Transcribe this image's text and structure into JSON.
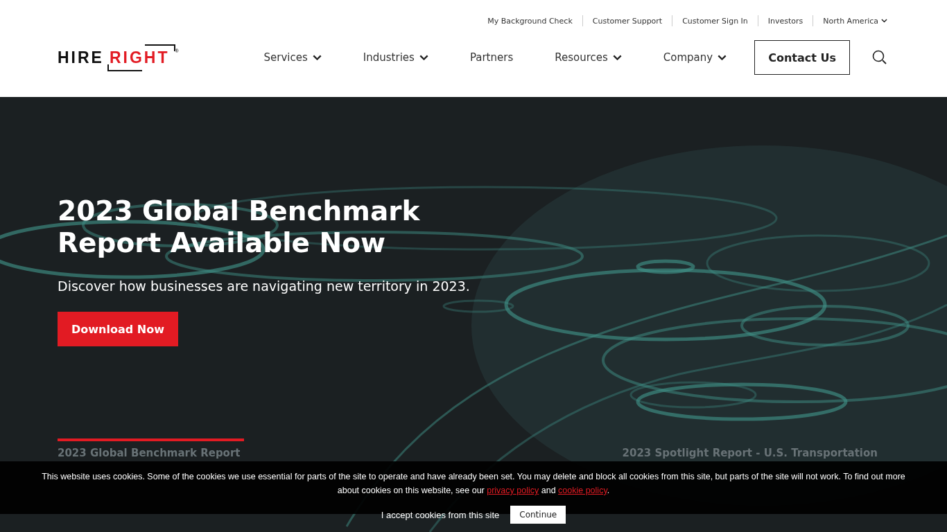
{
  "utility_links": [
    {
      "label": "My Background Check",
      "has_menu": false
    },
    {
      "label": "Customer Support",
      "has_menu": false
    },
    {
      "label": "Customer Sign In",
      "has_menu": false
    },
    {
      "label": "Investors",
      "has_menu": false
    },
    {
      "label": "North America",
      "has_menu": true
    }
  ],
  "logo": {
    "first": "HIRE",
    "second": "RIGHT",
    "mark": "®"
  },
  "nav": [
    {
      "label": "Services",
      "has_menu": true
    },
    {
      "label": "Industries",
      "has_menu": true
    },
    {
      "label": "Partners",
      "has_menu": false
    },
    {
      "label": "Resources",
      "has_menu": true
    },
    {
      "label": "Company",
      "has_menu": true
    }
  ],
  "contact_button": "Contact Us",
  "hero": {
    "kind": "picture",
    "title": "2023 Global Benchmark Report Available Now",
    "subtitle": "Discover how businesses are navigating new territory in 2023.",
    "button": "Download Now"
  },
  "slides": [
    {
      "label": "2023 Global Benchmark Report",
      "selected": true
    },
    {
      "label": "2023 Spotlight Report - U.S. Transportation",
      "selected": false
    }
  ],
  "cookie_banner": {
    "text": "This website uses cookies. Some of the cookies we use essential for parts of the site to operate and have already been set. You may delete and block all cookies from this site, but parts of the site will not work. To find out more about cookies on this website, see our",
    "link_1": "privacy policy",
    "joiner": "and",
    "link_2": "cookie policy",
    "end": ".",
    "accept_label": "I accept cookies from this site",
    "button": "Continue"
  }
}
